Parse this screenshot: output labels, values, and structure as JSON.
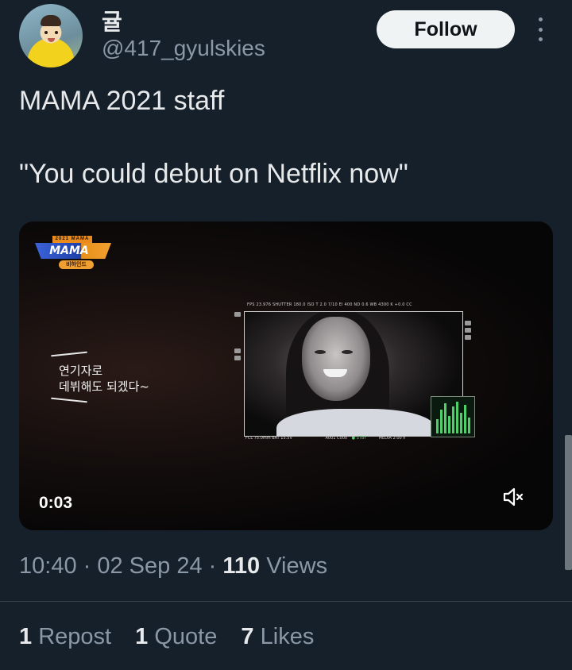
{
  "header": {
    "display_name": "귤",
    "handle": "@417_gyulskies",
    "follow_label": "Follow"
  },
  "tweet": {
    "lines": [
      "MAMA 2021 staff",
      "\"You could debut on Netflix now\""
    ]
  },
  "video": {
    "logo_top": "2021 MAMA",
    "logo_main": "MAMA",
    "logo_sub": "비하인드",
    "caption": "연기자로\n데뷔해도 되겠다~",
    "monitor_top": "FPS 23.976   SHUTTER 180.0   ISO T 2.0   7/10   EI 400   ND 0.6   WB   4300 K   +0.0 CC",
    "monitor_bottom_left": "FCL 75.0mm     BAT 15.5V",
    "monitor_bottom_mid": "A001  C000",
    "monitor_bottom_stby": "● STBY",
    "monitor_bottom_right": "MEDIA 2:00 h",
    "time": "0:03",
    "muted": true
  },
  "meta": {
    "time": "10:40",
    "date": "02 Sep 24",
    "views_count": "110",
    "views_label": "Views"
  },
  "stats": {
    "reposts_count": "1",
    "reposts_label": "Repost",
    "quotes_count": "1",
    "quotes_label": "Quote",
    "likes_count": "7",
    "likes_label": "Likes"
  },
  "colors": {
    "background": "#15202b",
    "text_primary": "#e7e9ea",
    "text_secondary": "#8b98a5",
    "follow_bg": "#eff3f4"
  },
  "icons": {
    "more": "more-dots-icon",
    "mute": "speaker-muted-icon"
  }
}
